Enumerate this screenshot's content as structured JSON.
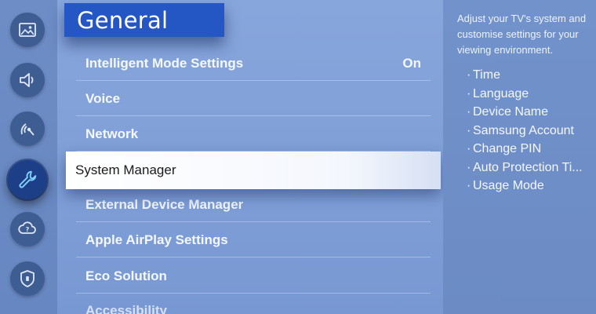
{
  "title": "General",
  "menu": [
    {
      "label": "Intelligent Mode Settings",
      "value": "On"
    },
    {
      "label": "Voice",
      "value": ""
    },
    {
      "label": "Network",
      "value": ""
    },
    {
      "label": "System Manager",
      "value": ""
    },
    {
      "label": "External Device Manager",
      "value": ""
    },
    {
      "label": "Apple AirPlay Settings",
      "value": ""
    },
    {
      "label": "Eco Solution",
      "value": ""
    },
    {
      "label": "Accessibility",
      "value": ""
    }
  ],
  "selected_item": "System Manager",
  "description": {
    "text": "Adjust your TV's system and customise settings for your viewing environment.",
    "items": [
      "Time",
      "Language",
      "Device Name",
      "Samsung Account",
      "Change PIN",
      "Auto Protection Ti...",
      "Usage Mode"
    ]
  },
  "rail": [
    {
      "icon": "picture-icon",
      "active": false
    },
    {
      "icon": "sound-icon",
      "active": false
    },
    {
      "icon": "broadcast-icon",
      "active": false
    },
    {
      "icon": "wrench-icon",
      "active": true
    },
    {
      "icon": "support-icon",
      "active": false
    },
    {
      "icon": "shield-icon",
      "active": false
    }
  ],
  "colors": {
    "title_bg": "#2457c4",
    "active_rail": "#1d3f87",
    "panel": "#7f9ed7"
  }
}
